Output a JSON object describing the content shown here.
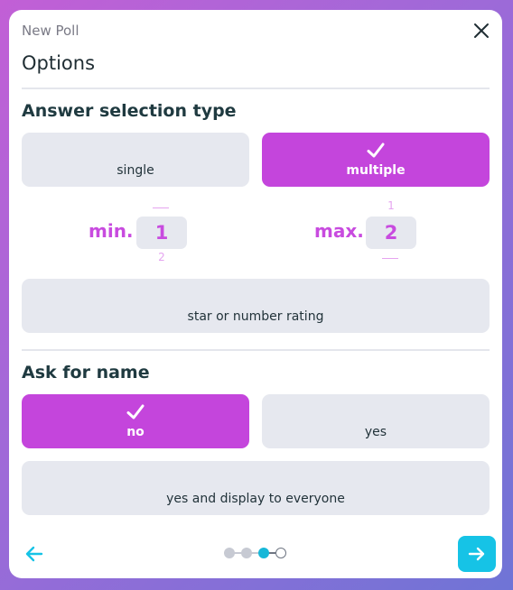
{
  "window": {
    "title": "New Poll",
    "close_icon": "close-icon"
  },
  "section": {
    "title": "Options"
  },
  "answer_selection": {
    "heading": "Answer selection type",
    "options": [
      {
        "label": "single",
        "selected": false
      },
      {
        "label": "multiple",
        "selected": true
      },
      {
        "label": "star or number rating",
        "selected": false
      }
    ],
    "min": {
      "label": "min.",
      "value": "1",
      "prev_value": "",
      "next_value": "2"
    },
    "max": {
      "label": "max.",
      "value": "2",
      "prev_value": "1",
      "next_value": ""
    }
  },
  "ask_for_name": {
    "heading": "Ask for name",
    "options": [
      {
        "label": "no",
        "selected": true
      },
      {
        "label": "yes",
        "selected": false
      },
      {
        "label": "yes and display to everyone",
        "selected": false
      }
    ]
  },
  "navigation": {
    "prev_icon": "arrow-left-icon",
    "next_icon": "arrow-right-icon",
    "total_steps": 4,
    "current_step": 3
  },
  "colors": {
    "accent": "#c445dc",
    "accent_text": "#c84bdf",
    "nav_accent": "#16c3e6",
    "option_bg": "#e6e8ef",
    "background_start": "#c25fd6",
    "background_end": "#6f74d6"
  }
}
